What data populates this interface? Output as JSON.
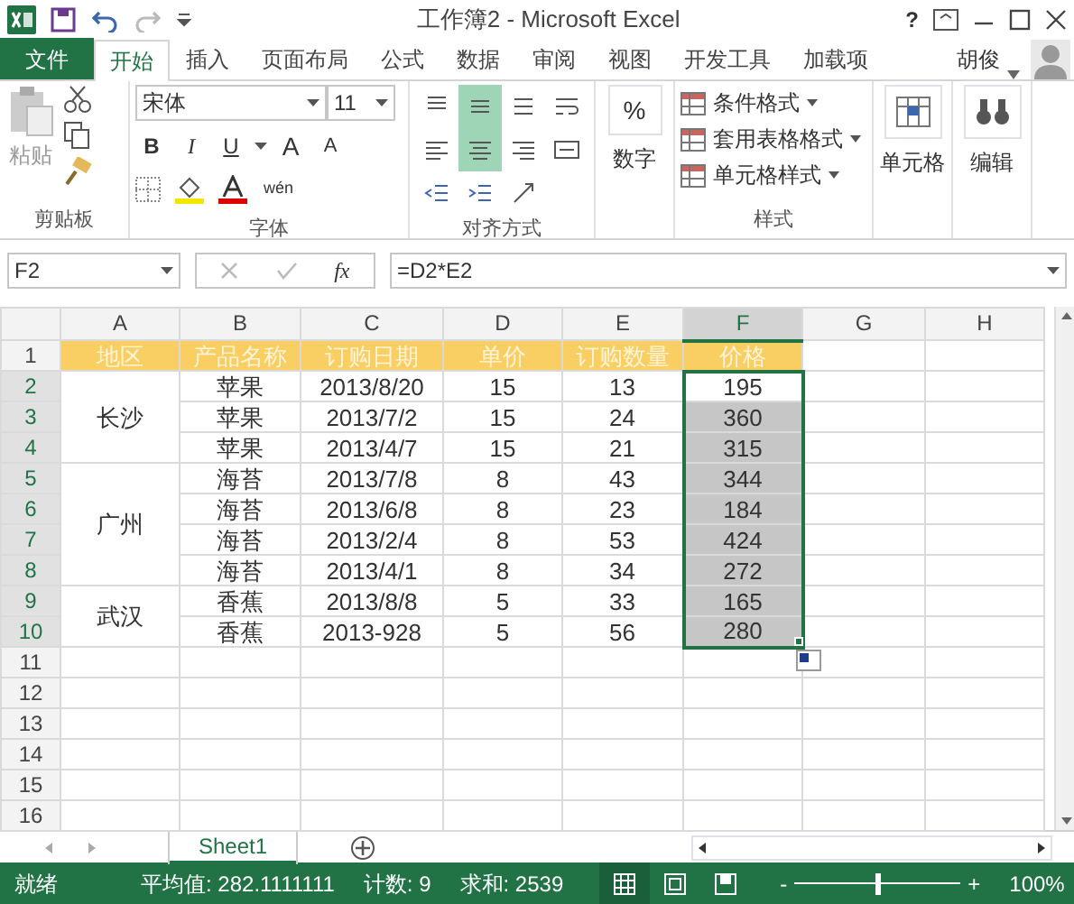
{
  "title_bar": {
    "title": "工作簿2 - Microsoft Excel",
    "help": "?"
  },
  "ribbon_tabs": [
    {
      "label": "文件",
      "kind": "file",
      "selected": false
    },
    {
      "label": "开始",
      "kind": "tab",
      "selected": true
    },
    {
      "label": "插入",
      "kind": "tab",
      "selected": false
    },
    {
      "label": "页面布局",
      "kind": "tab",
      "selected": false
    },
    {
      "label": "公式",
      "kind": "tab",
      "selected": false
    },
    {
      "label": "数据",
      "kind": "tab",
      "selected": false
    },
    {
      "label": "审阅",
      "kind": "tab",
      "selected": false
    },
    {
      "label": "视图",
      "kind": "tab",
      "selected": false
    },
    {
      "label": "开发工具",
      "kind": "tab",
      "selected": false
    },
    {
      "label": "加载项",
      "kind": "tab",
      "selected": false
    }
  ],
  "user": {
    "name": "胡俊"
  },
  "ribbon": {
    "clipboard": {
      "label": "剪贴板",
      "paste": "粘贴"
    },
    "font": {
      "label": "字体",
      "font_name": "宋体",
      "font_size": "11",
      "bold": "B",
      "italic": "I",
      "underline": "U",
      "grow": "A",
      "shrink": "A",
      "phonetic": "wén"
    },
    "alignment": {
      "label": "对齐方式",
      "buttons": [
        {
          "kind": "top",
          "selected": false
        },
        {
          "kind": "middle",
          "selected": true
        },
        {
          "kind": "bottom",
          "selected": false
        },
        {
          "kind": "wrap",
          "selected": false
        },
        {
          "kind": "left",
          "selected": false
        },
        {
          "kind": "center",
          "selected": true
        },
        {
          "kind": "right",
          "selected": false
        },
        {
          "kind": "merge",
          "selected": false
        },
        {
          "kind": "outdent",
          "selected": false
        },
        {
          "kind": "indent",
          "selected": false
        },
        {
          "kind": "orient",
          "selected": false
        }
      ]
    },
    "number": {
      "symbol": "%",
      "label": "数字"
    },
    "styles": {
      "label": "样式",
      "items": [
        "条件格式",
        "套用表格格式",
        "单元格样式"
      ]
    },
    "cells": {
      "label": "单元格"
    },
    "editing": {
      "label": "编辑"
    }
  },
  "formula_bar": {
    "name_box": "F2",
    "fx": "fx",
    "formula": "=D2*E2"
  },
  "sheet": {
    "columns": [
      {
        "label": "A",
        "selected": false
      },
      {
        "label": "B",
        "selected": false
      },
      {
        "label": "C",
        "selected": false
      },
      {
        "label": "D",
        "selected": false
      },
      {
        "label": "E",
        "selected": false
      },
      {
        "label": "F",
        "selected": true
      },
      {
        "label": "G",
        "selected": false
      },
      {
        "label": "H",
        "selected": false
      }
    ],
    "header_row": {
      "number": "1",
      "cells": [
        "地区",
        "产品名称",
        "订购日期",
        "单价",
        "订购数量",
        "价格"
      ]
    },
    "groups": [
      {
        "region": "长沙",
        "rows": [
          {
            "number": "2",
            "selected": true,
            "active": true,
            "cells": [
              "苹果",
              "2013/8/20",
              "15",
              "13",
              "195"
            ]
          },
          {
            "number": "3",
            "selected": true,
            "active": false,
            "cells": [
              "苹果",
              "2013/7/2",
              "15",
              "24",
              "360"
            ]
          },
          {
            "number": "4",
            "selected": true,
            "active": false,
            "cells": [
              "苹果",
              "2013/4/7",
              "15",
              "21",
              "315"
            ]
          }
        ]
      },
      {
        "region": "广州",
        "rows": [
          {
            "number": "5",
            "selected": true,
            "active": false,
            "cells": [
              "海苔",
              "2013/7/8",
              "8",
              "43",
              "344"
            ]
          },
          {
            "number": "6",
            "selected": true,
            "active": false,
            "cells": [
              "海苔",
              "2013/6/8",
              "8",
              "23",
              "184"
            ]
          },
          {
            "number": "7",
            "selected": true,
            "active": false,
            "cells": [
              "海苔",
              "2013/2/4",
              "8",
              "53",
              "424"
            ]
          },
          {
            "number": "8",
            "selected": true,
            "active": false,
            "cells": [
              "海苔",
              "2013/4/1",
              "8",
              "34",
              "272"
            ]
          }
        ]
      },
      {
        "region": "武汉",
        "rows": [
          {
            "number": "9",
            "selected": true,
            "active": false,
            "cells": [
              "香蕉",
              "2013/8/8",
              "5",
              "33",
              "165"
            ]
          },
          {
            "number": "10",
            "selected": true,
            "active": false,
            "cells": [
              "香蕉",
              "2013-928",
              "5",
              "56",
              "280"
            ]
          }
        ]
      }
    ],
    "empty_rows": [
      "11",
      "12",
      "13",
      "14",
      "15",
      "16"
    ]
  },
  "sheet_tabs": [
    {
      "label": "Sheet1",
      "selected": true
    }
  ],
  "status_bar": {
    "ready": "就绪",
    "average": "平均值: 282.1111111",
    "count": "计数: 9",
    "sum": "求和: 2539",
    "views": [
      {
        "kind": "normal",
        "selected": true
      },
      {
        "kind": "layout",
        "selected": false
      },
      {
        "kind": "break",
        "selected": false
      }
    ],
    "zoom_minus": "-",
    "zoom_plus": "+",
    "zoom": {
      "level": 0.5
    },
    "zoom_label": "100%"
  }
}
